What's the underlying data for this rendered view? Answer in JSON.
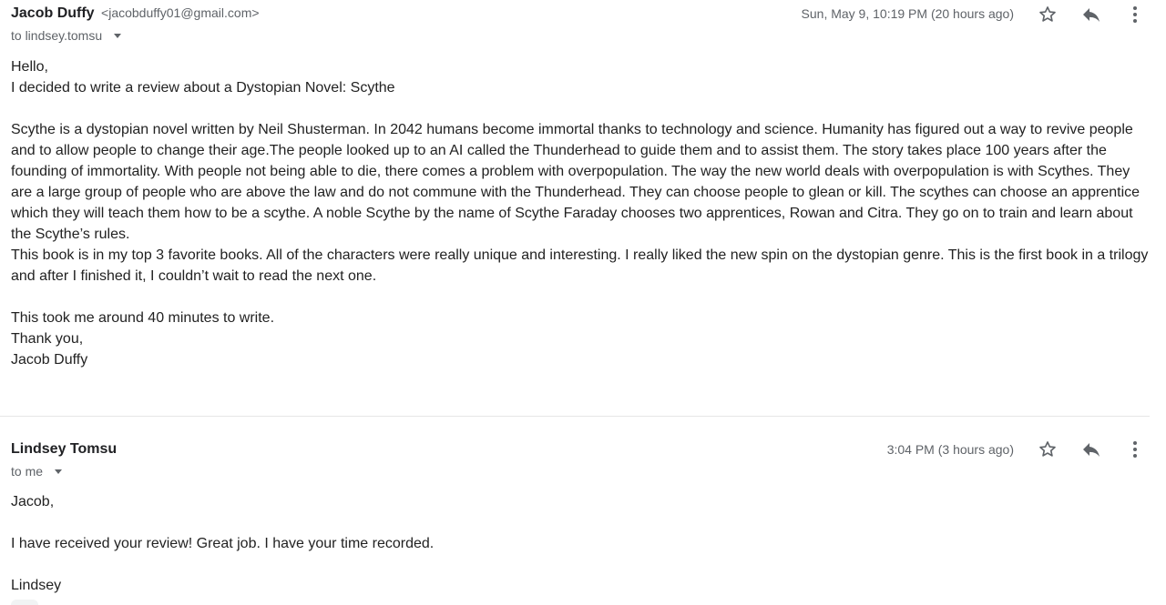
{
  "messages": [
    {
      "sender_name": "Jacob Duffy",
      "sender_email": "<jacobduffy01@gmail.com>",
      "recipient": "to lindsey.tomsu",
      "date": "Sun, May 9, 10:19 PM (20 hours ago)",
      "body": [
        "Hello,",
        "I decided to write a review about a Dystopian Novel: Scythe",
        "",
        "Scythe is a dystopian novel written by Neil Shusterman. In 2042 humans become immortal thanks to technology and science. Humanity has figured out a way to revive people and to allow people to change their age.The people looked up to an AI called the Thunderhead to guide them and to assist them. The story takes place 100 years after the founding of immortality.  With people not being able to die, there comes a problem with overpopulation.  The way the new world deals with overpopulation is with Scythes. They are a large group of people who are above the law and do not commune with the Thunderhead.  They can choose people to glean or kill. The scythes can choose an apprentice which they will teach them how to be a scythe. A noble Scythe by the name of Scythe Faraday chooses two apprentices, Rowan and Citra. They go on to train and learn about the Scythe’s rules.",
        "This book is in my top 3 favorite books. All of the characters were really unique and interesting. I really liked the new spin on the dystopian genre.  This is the first book in a trilogy and after I finished it, I couldn’t wait to read the next one.",
        "",
        "This took me around 40 minutes to write.",
        "Thank you,",
        "Jacob Duffy"
      ]
    },
    {
      "sender_name": "Lindsey Tomsu",
      "recipient": "to me",
      "date": "3:04 PM (3 hours ago)",
      "body": [
        "Jacob,",
        "",
        "I have received your review! Great job. I have your time recorded.",
        "",
        "Lindsey"
      ]
    }
  ],
  "icons": {
    "star": "star-icon",
    "reply": "reply-icon",
    "more": "more-vert-icon",
    "caret": "caret-down-icon"
  },
  "colors": {
    "sender": "#202124",
    "secondary_text": "#5f6368",
    "body_text": "#222222",
    "divider": "#e6e6e6"
  }
}
